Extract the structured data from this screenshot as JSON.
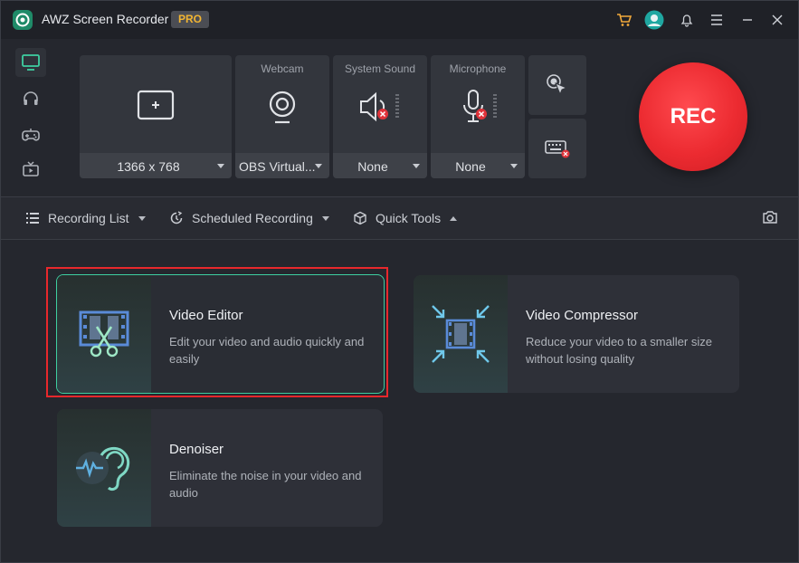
{
  "app": {
    "title": "AWZ Screen Recorder",
    "badge": "PRO"
  },
  "titlebar_icons": [
    "cart-icon",
    "user-avatar-icon",
    "bell-icon",
    "menu-icon",
    "minimize-icon",
    "close-icon"
  ],
  "sidebar": [
    {
      "name": "screen-mode",
      "icon": "monitor-icon",
      "active": true
    },
    {
      "name": "audio-mode",
      "icon": "headphones-icon",
      "active": false
    },
    {
      "name": "game-mode",
      "icon": "gamepad-icon",
      "active": false
    },
    {
      "name": "tv-mode",
      "icon": "tv-icon",
      "active": false
    }
  ],
  "sources": {
    "region": {
      "value": "1366 x 768"
    },
    "webcam": {
      "label": "Webcam",
      "value": "OBS Virtual..."
    },
    "system_sound": {
      "label": "System Sound",
      "value": "None"
    },
    "microphone": {
      "label": "Microphone",
      "value": "None"
    }
  },
  "rec_button": "REC",
  "toolbar": {
    "recording_list": "Recording List",
    "scheduled_recording": "Scheduled Recording",
    "quick_tools": "Quick Tools"
  },
  "cards": [
    {
      "title": "Video Editor",
      "desc": "Edit your video and audio quickly and easily"
    },
    {
      "title": "Video Compressor",
      "desc": "Reduce your video to a smaller size without losing quality"
    },
    {
      "title": "Denoiser",
      "desc": "Eliminate the noise in your video and audio"
    }
  ],
  "colors": {
    "accent": "#3ecfa1",
    "rec": "#ec2b31",
    "highlight": "#e8282c",
    "badge_text": "#f2b532"
  }
}
